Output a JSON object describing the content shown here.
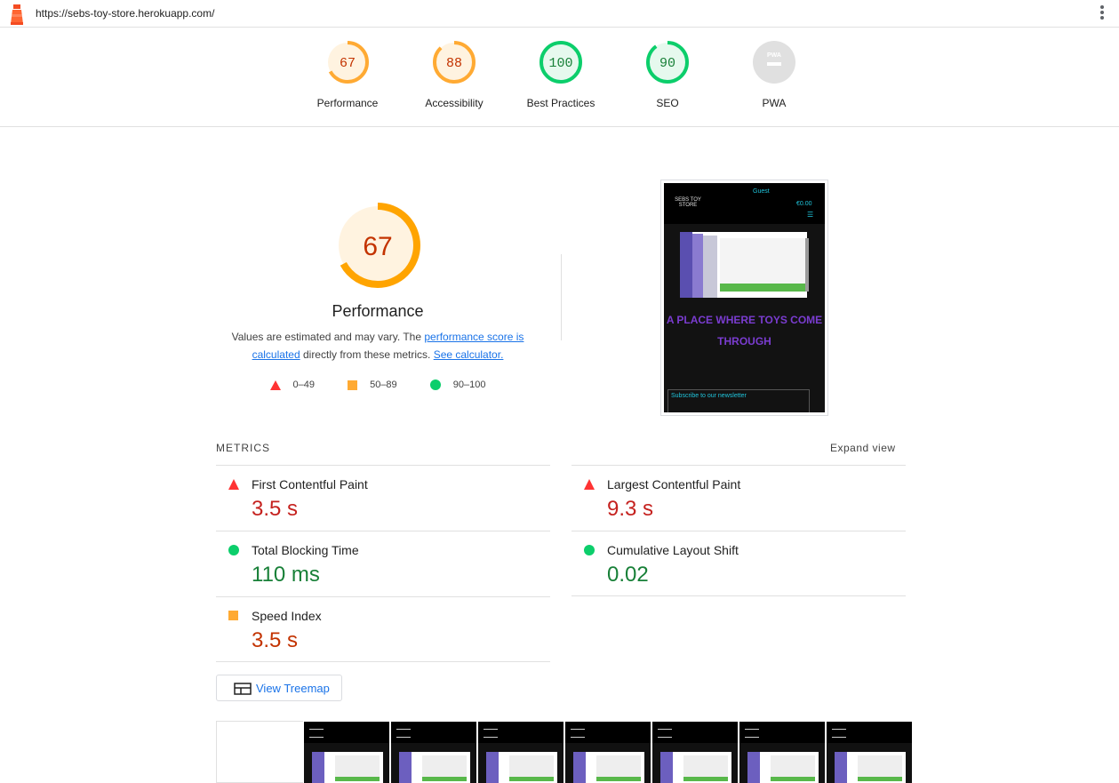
{
  "topbar": {
    "url": "https://sebs-toy-store.herokuapp.com/"
  },
  "gauges": [
    {
      "label": "Performance",
      "score": "67",
      "value": 67,
      "status": "average"
    },
    {
      "label": "Accessibility",
      "score": "88",
      "value": 88,
      "status": "average"
    },
    {
      "label": "Best Practices",
      "score": "100",
      "value": 100,
      "status": "pass"
    },
    {
      "label": "SEO",
      "score": "90",
      "value": 90,
      "status": "pass"
    },
    {
      "label": "PWA",
      "score": "",
      "value": null,
      "status": "na",
      "badge": "PWA"
    }
  ],
  "performance": {
    "score": "67",
    "value": 67,
    "title": "Performance",
    "desc_prefix": "Values are estimated and may vary. The ",
    "desc_link1": "performance score is calculated",
    "desc_middle": " directly from these metrics. ",
    "desc_link2": "See calculator.",
    "legend": [
      {
        "range": "0–49",
        "shape": "triangle",
        "color": "#ff3333"
      },
      {
        "range": "50–89",
        "shape": "square",
        "color": "#ffaa33"
      },
      {
        "range": "90–100",
        "shape": "circle",
        "color": "#0cce6b"
      }
    ]
  },
  "screenshot": {
    "logo": "SEBS TOY STORE",
    "guest": "Guest",
    "cart": "€0.00",
    "tagline": "A PLACE WHERE TOYS COME THROUGH",
    "newsletter": "Subscribe to our newsletter"
  },
  "metrics": {
    "heading": "METRICS",
    "expand": "Expand view",
    "items": [
      {
        "name": "First Contentful Paint",
        "value": "3.5 s",
        "status": "fail"
      },
      {
        "name": "Largest Contentful Paint",
        "value": "9.3 s",
        "status": "fail"
      },
      {
        "name": "Total Blocking Time",
        "value": "110 ms",
        "status": "pass"
      },
      {
        "name": "Cumulative Layout Shift",
        "value": "0.02",
        "status": "pass"
      },
      {
        "name": "Speed Index",
        "value": "3.5 s",
        "status": "average"
      }
    ]
  },
  "treemap": {
    "label": "View Treemap"
  },
  "colors": {
    "fail": "#ff3333",
    "average": "#ffaa33",
    "pass": "#0cce6b",
    "link": "#1a73e8"
  }
}
